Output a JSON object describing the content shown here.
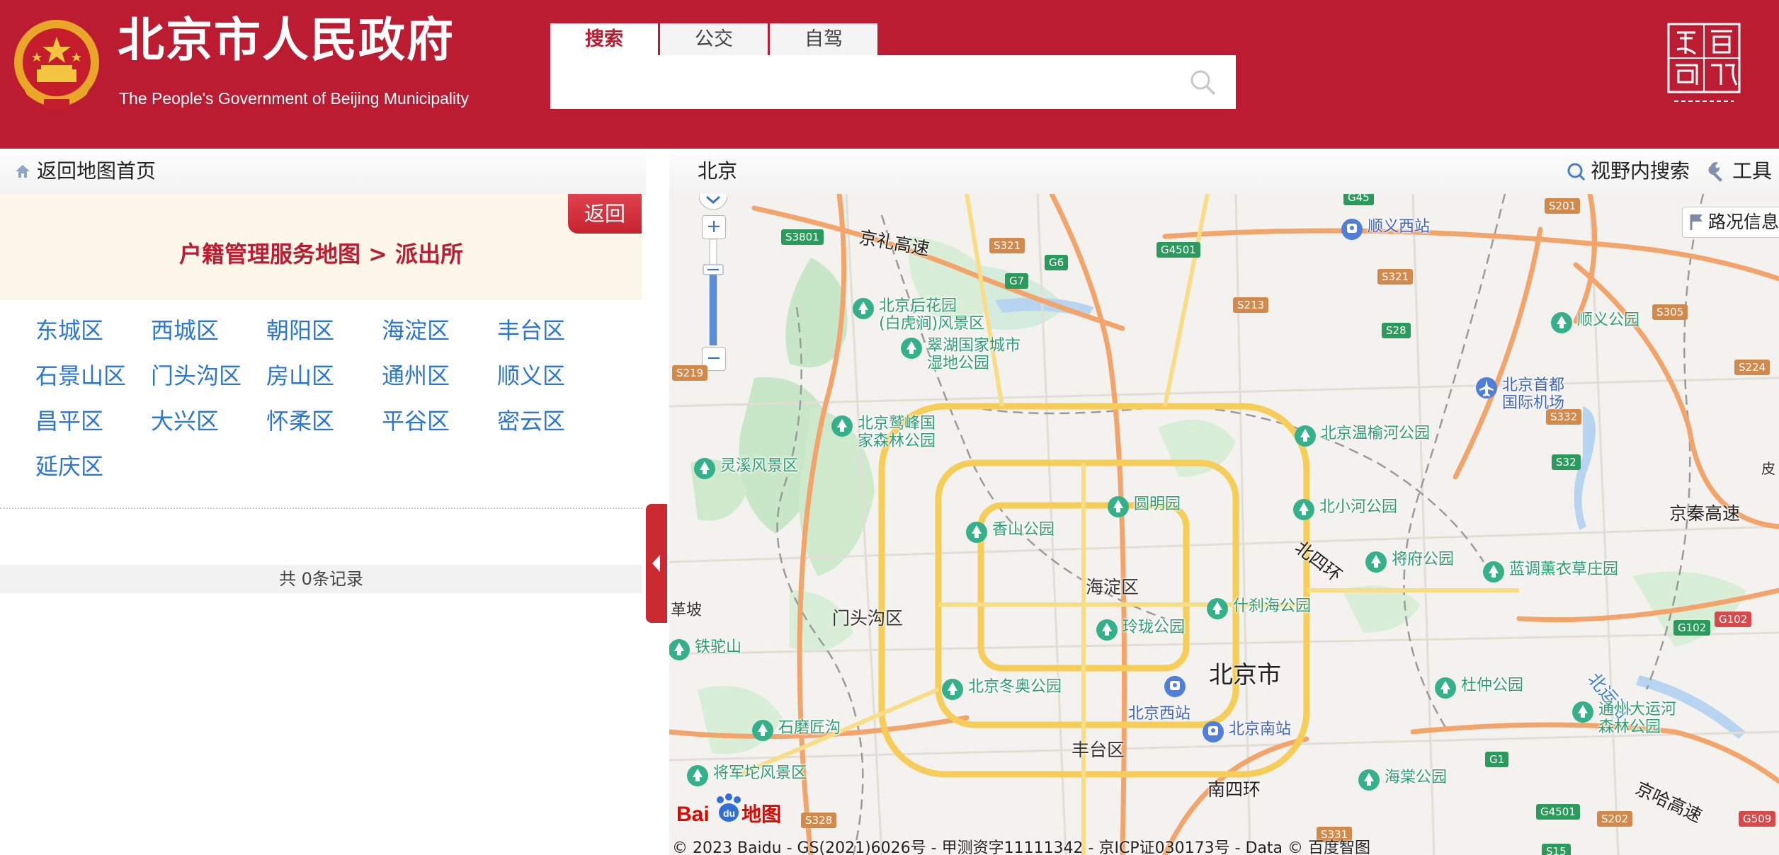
{
  "header": {
    "site_title": "北京市人民政府",
    "site_subtitle": "The People's Government of Beijing Municipality",
    "search_tabs": [
      {
        "label": "搜索",
        "active": true
      },
      {
        "label": "公交",
        "active": false
      },
      {
        "label": "自驾",
        "active": false
      }
    ],
    "search_placeholder": "",
    "capital_logo_icon": "capital-window-logo-icon",
    "colors": {
      "brand_red": "#bb1c31",
      "link_blue": "#2a76d2"
    }
  },
  "left_panel": {
    "back_home_label": "返回地图首页",
    "back_button_label": "返回",
    "breadcrumb": "户籍管理服务地图 > 派出所",
    "districts": [
      "东城区",
      "西城区",
      "朝阳区",
      "海淀区",
      "丰台区",
      "石景山区",
      "门头沟区",
      "房山区",
      "通州区",
      "顺义区",
      "昌平区",
      "大兴区",
      "怀柔区",
      "平谷区",
      "密云区",
      "延庆区"
    ],
    "records_text": "共 0条记录"
  },
  "map_panel": {
    "city": "北京",
    "view_search_label": "视野内搜索",
    "tools_label": "工具",
    "traffic_label": "路况信息",
    "zoom_in": "+",
    "zoom_out": "−",
    "copyright": "© 2023 Baidu - GS(2021)6026号 - 甲测资字11111342 - 京ICP证030173号 - Data © 百度智图",
    "logo_text": "地图",
    "districts": [
      "北京市",
      "海淀区",
      "门头沟区",
      "丰台区"
    ],
    "highways": [
      "京礼高速",
      "京秦高速",
      "京哈高速",
      "北四环",
      "南四环",
      "北运河"
    ],
    "edge_labels": [
      "革坡",
      "皮"
    ],
    "shields": [
      "S3801",
      "S321",
      "G6",
      "G7",
      "G4501",
      "G45",
      "S201",
      "S213",
      "S321",
      "S28",
      "S219",
      "S305",
      "S224",
      "S332",
      "S32",
      "G102",
      "G102",
      "G1",
      "S328",
      "S331",
      "G4501",
      "S202",
      "G509",
      "S15"
    ],
    "pois": [
      {
        "name": "顺义西站",
        "type": "transit"
      },
      {
        "name": "北京后花园\n(白虎涧)风景区",
        "type": "park"
      },
      {
        "name": "翠湖国家城市\n湿地公园",
        "type": "park"
      },
      {
        "name": "顺义公园",
        "type": "park"
      },
      {
        "name": "北京首都\n国际机场",
        "type": "transit"
      },
      {
        "name": "北京鹫峰国\n家森林公园",
        "type": "park"
      },
      {
        "name": "北京温榆河公园",
        "type": "park"
      },
      {
        "name": "灵溪风景区",
        "type": "park"
      },
      {
        "name": "圆明园",
        "type": "park"
      },
      {
        "name": "北小河公园",
        "type": "park"
      },
      {
        "name": "香山公园",
        "type": "park"
      },
      {
        "name": "将府公园",
        "type": "park"
      },
      {
        "name": "蓝调薰衣草庄园",
        "type": "park"
      },
      {
        "name": "什刹海公园",
        "type": "park"
      },
      {
        "name": "玲珑公园",
        "type": "park"
      },
      {
        "name": "铁驼山",
        "type": "park"
      },
      {
        "name": "北京冬奥公园",
        "type": "park"
      },
      {
        "name": "北京西站",
        "type": "transit"
      },
      {
        "name": "北京南站",
        "type": "transit"
      },
      {
        "name": "杜仲公园",
        "type": "park"
      },
      {
        "name": "通州大运河\n森林公园",
        "type": "park"
      },
      {
        "name": "石磨匠沟",
        "type": "park"
      },
      {
        "name": "将军坨风景区",
        "type": "park"
      },
      {
        "name": "海棠公园",
        "type": "park"
      }
    ]
  }
}
